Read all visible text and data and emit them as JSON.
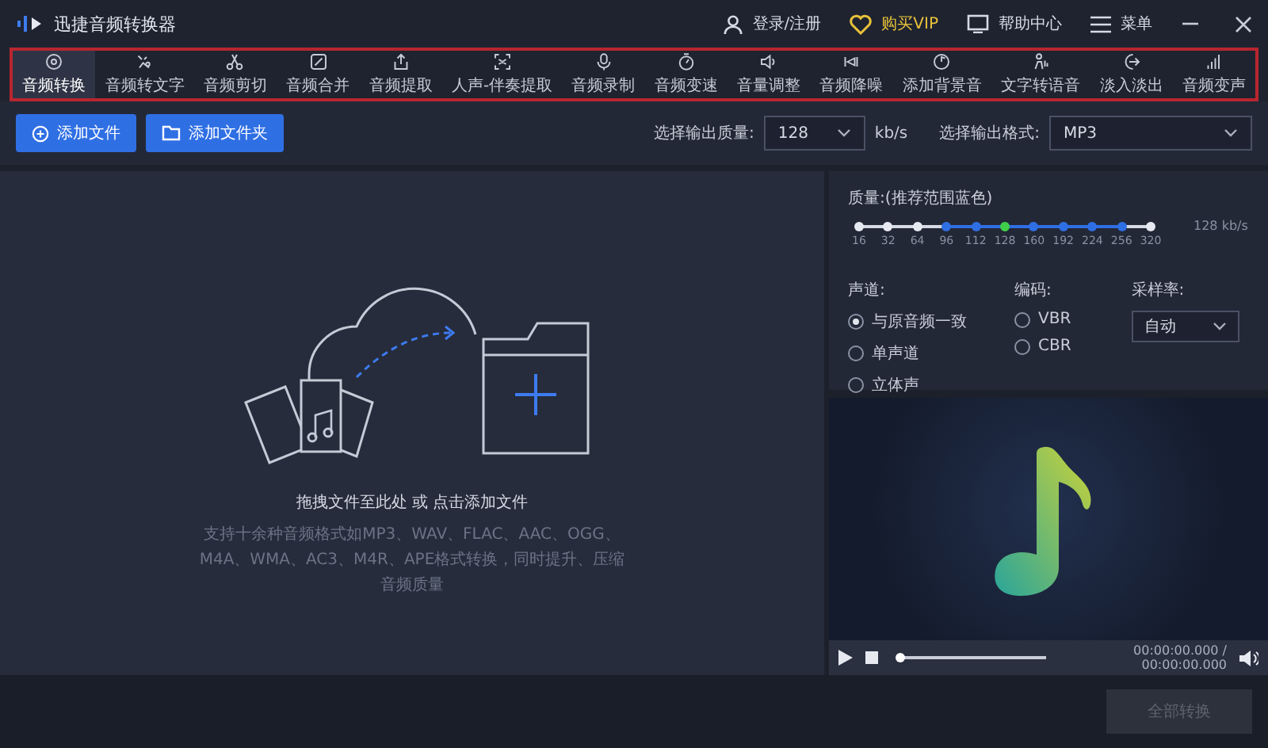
{
  "window": {
    "title": "迅捷音频转换器"
  },
  "header_links": [
    {
      "kind": "user",
      "label": "登录/注册"
    },
    {
      "kind": "vip",
      "label": "购买VIP"
    },
    {
      "kind": "help",
      "label": "帮助中心"
    },
    {
      "kind": "menu",
      "label": "菜单"
    }
  ],
  "tools": [
    {
      "label": "音频转换",
      "selected": true
    },
    {
      "label": "音频转文字",
      "selected": false
    },
    {
      "label": "音频剪切",
      "selected": false
    },
    {
      "label": "音频合并",
      "selected": false
    },
    {
      "label": "音频提取",
      "selected": false
    },
    {
      "label": "人声-伴奏提取",
      "selected": false
    },
    {
      "label": "音频录制",
      "selected": false
    },
    {
      "label": "音频变速",
      "selected": false
    },
    {
      "label": "音量调整",
      "selected": false
    },
    {
      "label": "音频降噪",
      "selected": false
    },
    {
      "label": "添加背景音",
      "selected": false
    },
    {
      "label": "文字转语音",
      "selected": false
    },
    {
      "label": "淡入淡出",
      "selected": false
    },
    {
      "label": "音频变声",
      "selected": false
    }
  ],
  "actions": {
    "buttons": [
      {
        "kind": "file",
        "label": "添加文件"
      },
      {
        "kind": "folder",
        "label": "添加文件夹"
      }
    ],
    "quality_label": "选择输出质量:",
    "quality_value": "128",
    "quality_unit": "kb/s",
    "format_label": "选择输出格式:",
    "format_value": "MP3"
  },
  "dropzone": {
    "hint": "拖拽文件至此处 或 点击添加文件",
    "formats": "支持十余种音频格式如MP3、WAV、FLAC、AAC、OGG、M4A、WMA、AC3、M4R、APE格式转换，同时提升、压缩音频质量"
  },
  "settings": {
    "quality_title": "质量:(推荐范围蓝色)",
    "reading": "128 kb/s",
    "ticks": [
      {
        "label": "16",
        "recommended": false,
        "selected": false
      },
      {
        "label": "32",
        "recommended": false,
        "selected": false
      },
      {
        "label": "64",
        "recommended": false,
        "selected": false
      },
      {
        "label": "96",
        "recommended": true,
        "selected": false
      },
      {
        "label": "112",
        "recommended": true,
        "selected": false
      },
      {
        "label": "128",
        "recommended": true,
        "selected": true
      },
      {
        "label": "160",
        "recommended": true,
        "selected": false
      },
      {
        "label": "192",
        "recommended": true,
        "selected": false
      },
      {
        "label": "224",
        "recommended": true,
        "selected": false
      },
      {
        "label": "256",
        "recommended": true,
        "selected": false
      },
      {
        "label": "320",
        "recommended": false,
        "selected": false
      }
    ],
    "channel": {
      "title": "声道:",
      "options": [
        {
          "label": "与原音频一致",
          "selected": true
        },
        {
          "label": "单声道",
          "selected": false
        },
        {
          "label": "立体声",
          "selected": false
        }
      ]
    },
    "encoding": {
      "title": "编码:",
      "options": [
        {
          "label": "VBR",
          "selected": false
        },
        {
          "label": "CBR",
          "selected": false
        }
      ]
    },
    "sample_rate": {
      "title": "采样率:",
      "value": "自动"
    }
  },
  "player": {
    "level": 0,
    "time": "00:00:00.000 / 00:00:00.000"
  },
  "footer": {
    "button": "全部转换"
  }
}
